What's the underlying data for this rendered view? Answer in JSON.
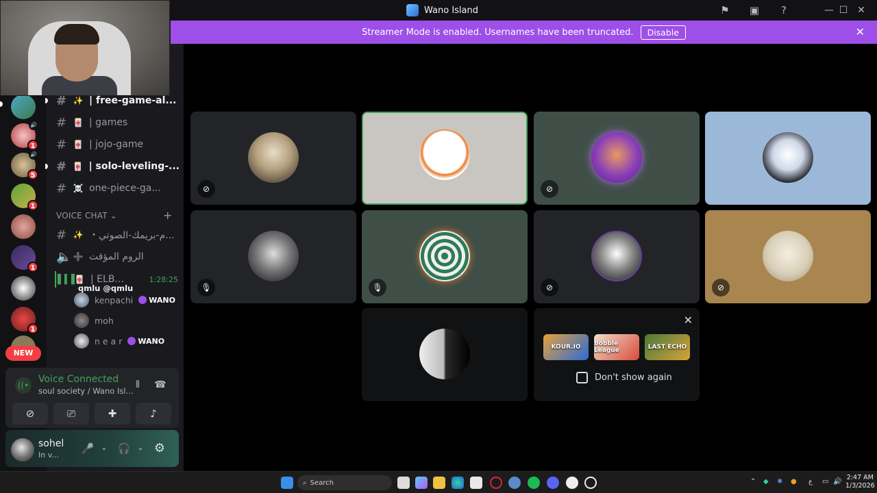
{
  "window": {
    "title": "Wano Island",
    "controls": [
      "—",
      "☐",
      "✕"
    ]
  },
  "banner": {
    "text": "Streamer Mode is enabled. Usernames have been truncated.",
    "button": "Disable"
  },
  "rail": {
    "badges": [
      "1",
      "5",
      "1",
      "1",
      "1"
    ],
    "new_label": "NEW"
  },
  "channels": [
    {
      "name": "| free-game-al...",
      "emoji": "✨",
      "unread": true
    },
    {
      "name": "| games",
      "emoji": "🀄",
      "unread": false
    },
    {
      "name": "| jojo-game",
      "emoji": "🀄",
      "unread": false
    },
    {
      "name": "| solo-leveling-...",
      "emoji": "🀄",
      "unread": true
    },
    {
      "name": "one-piece-ga...",
      "emoji": "☠️",
      "unread": false
    }
  ],
  "voice_category": "VOICE CHAT",
  "voice_channels": [
    {
      "name": "・م-بريمك-الصوتي...",
      "emoji": "✨"
    },
    {
      "name": "الروم المؤقت",
      "emoji": "➕"
    }
  ],
  "active_voice": {
    "name": "| ELB...",
    "timer": "1:28:25",
    "tooltip_user": "qmlu",
    "tooltip_handle": "@qmlu",
    "members": [
      {
        "name": "kenpachi",
        "tag": "WANO"
      },
      {
        "name": "moh",
        "tag": ""
      },
      {
        "name": "n e a r",
        "tag": "WANO"
      }
    ]
  },
  "voice_panel": {
    "status": "Voice Connected",
    "location": "soul society / Wano Isl..."
  },
  "user": {
    "name": "sohel",
    "status": "In v..."
  },
  "activity_card": {
    "games": [
      "KOUR.IO",
      "Bobble League",
      "LAST ECHO"
    ],
    "checkbox_label": "Don't show again"
  },
  "taskbar": {
    "search_placeholder": "Search",
    "time": "2:47 AM",
    "date": "1/3/2026",
    "lang": "ع"
  },
  "colors": {
    "banner": "#9d4fe8",
    "connected_green": "#43a25a",
    "badge_red": "#f23f43"
  }
}
